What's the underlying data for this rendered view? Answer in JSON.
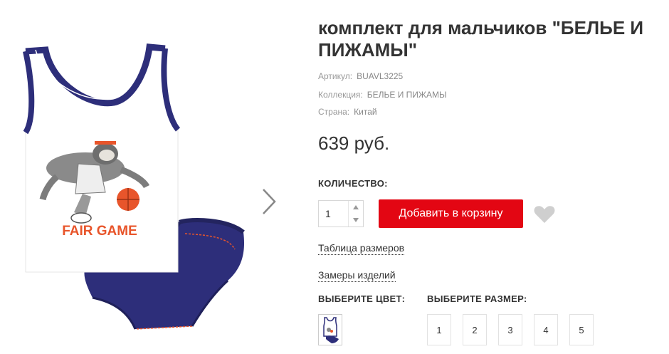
{
  "product": {
    "title": "комплект для мальчиков \"БЕЛЬЕ И ПИЖАМЫ\"",
    "article_label": "Артикул:",
    "article_value": "BUAVL3225",
    "collection_label": "Коллекция:",
    "collection_value": "БЕЛЬЕ И ПИЖАМЫ",
    "country_label": "Страна:",
    "country_value": "Китай",
    "price": "639 руб.",
    "image_print_text": "FAIR GAME"
  },
  "purchase": {
    "quantity_label": "КОЛИЧЕСТВО:",
    "quantity_value": "1",
    "add_to_cart_label": "Добавить в корзину"
  },
  "links": {
    "size_table": "Таблица размеров",
    "measurements": "Замеры изделий"
  },
  "options": {
    "color_label": "ВЫБЕРИТЕ ЦВЕТ:",
    "size_label": "ВЫБЕРИТЕ РАЗМЕР:",
    "sizes": [
      "1",
      "2",
      "3",
      "4",
      "5"
    ]
  },
  "colors": {
    "accent": "#e30613",
    "navy": "#2d2e7a",
    "orange": "#e8552b",
    "heart": "#cfcfcf"
  },
  "icons": {
    "next": "chevron-right-icon",
    "favorite": "heart-icon",
    "step_up": "caret-up-icon",
    "step_down": "caret-down-icon"
  }
}
